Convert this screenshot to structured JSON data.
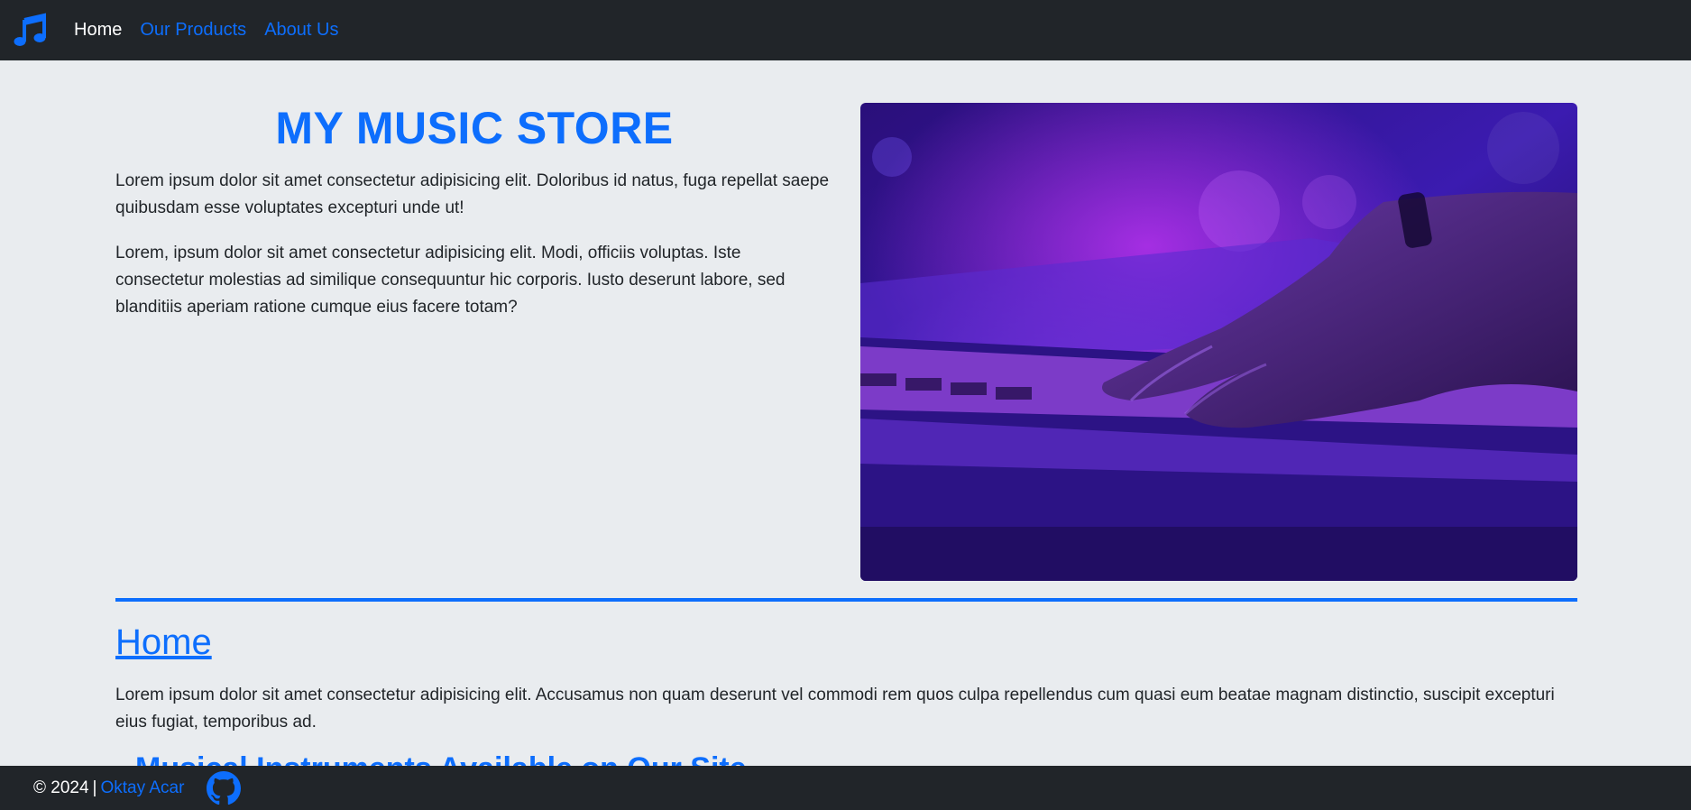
{
  "nav": {
    "brand_icon": "music-note-icon",
    "links": [
      {
        "label": "Home",
        "active": true
      },
      {
        "label": "Our Products",
        "active": false
      },
      {
        "label": "About Us",
        "active": false
      }
    ]
  },
  "hero": {
    "title": "MY MUSIC STORE",
    "paragraphs": [
      "Lorem ipsum dolor sit amet consectetur adipisicing elit. Doloribus id natus, fuga repellat saepe quibusdam esse voluptates excepturi unde ut!",
      "Lorem, ipsum dolor sit amet consectetur adipisicing elit. Modi, officiis voluptas. Iste consectetur molestias ad similique consequuntur hic corporis. Iusto deserunt labore, sed blanditiis aperiam ratione cumque eius facere totam?"
    ]
  },
  "section": {
    "title": "Home",
    "paragraph": "Lorem ipsum dolor sit amet consectetur adipisicing elit. Accusamus non quam deserunt vel commodi rem quos culpa repellendus cum quasi eum beatae magnam distinctio, suscipit excepturi eius fugiat, temporibus ad.",
    "subtitle": "Musical Instruments Available on Our Site"
  },
  "footer": {
    "copyright": "© 2024",
    "separator": "|",
    "author": "Oktay Acar",
    "github_icon": "github-icon"
  },
  "colors": {
    "accent": "#0d6efd",
    "navbar_bg": "#212529",
    "page_bg": "#e9ecef"
  }
}
